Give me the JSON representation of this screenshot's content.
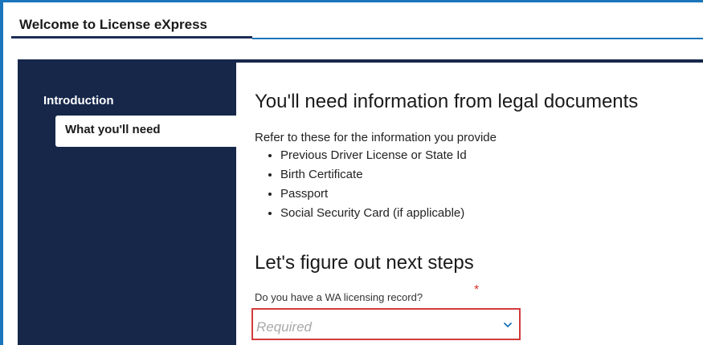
{
  "window": {
    "title": "Welcome to License eXpress"
  },
  "sidebar": {
    "section_label": "Introduction",
    "items": [
      {
        "label": "What you'll need",
        "active": true
      }
    ]
  },
  "main": {
    "heading": "You'll need information from legal documents",
    "intro": "Refer to these for the information you provide",
    "documents": [
      "Previous Driver License or State Id",
      "Birth Certificate",
      "Passport",
      "Social Security Card (if applicable)"
    ],
    "next_steps_heading": "Let's figure out next steps",
    "question": {
      "label": "Do you have a WA licensing record?",
      "required_marker": "*",
      "value": "",
      "placeholder": "Required"
    }
  },
  "colors": {
    "accent_blue": "#1b75bb",
    "sidebar_navy": "#16274a",
    "error_red": "#d33b3b"
  },
  "icons": {
    "select_chevron": "chevron-down-icon"
  }
}
